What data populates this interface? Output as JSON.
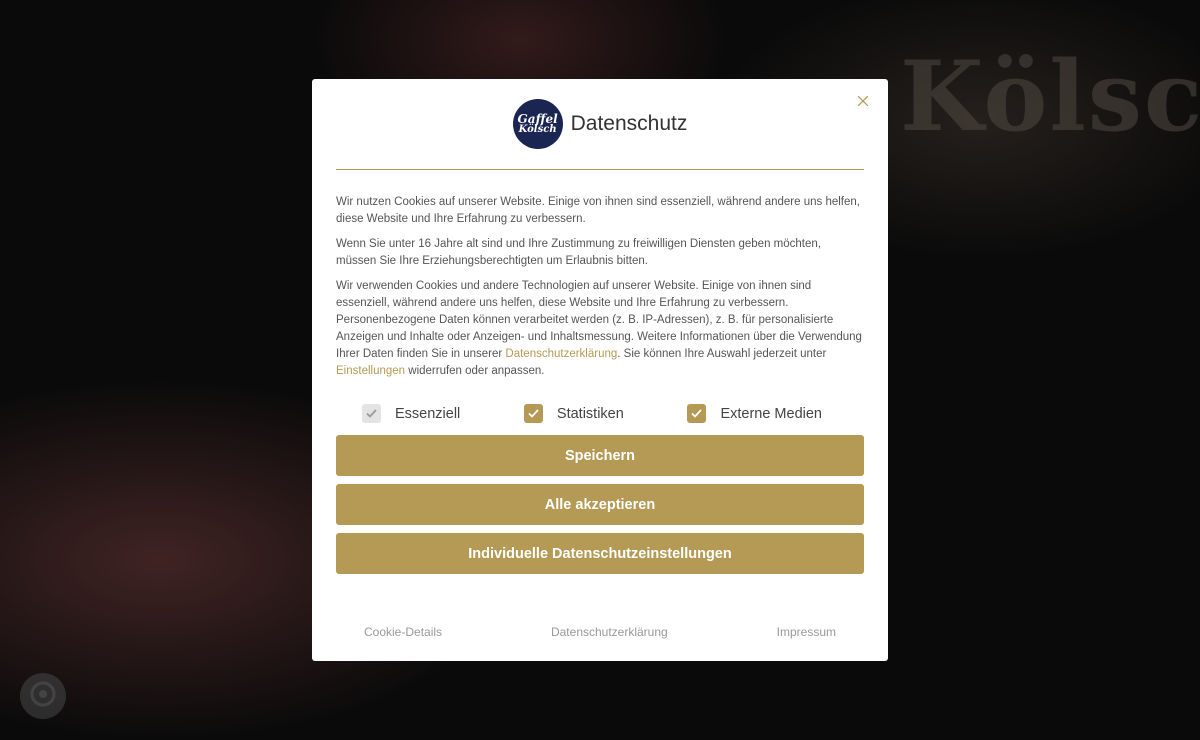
{
  "background": {
    "text": "Kölsch"
  },
  "modal": {
    "title": "Datenschutz",
    "logo": {
      "line1": "Gaffel",
      "line2": "Kölsch"
    },
    "paragraphs": [
      "Wir nutzen Cookies auf unserer Website. Einige von ihnen sind essenziell, während andere uns helfen, diese Website und Ihre Erfahrung zu verbessern.",
      "Wenn Sie unter 16 Jahre alt sind und Ihre Zustimmung zu freiwilligen Diensten geben möchten, müssen Sie Ihre Erziehungsberechtigten um Erlaubnis bitten."
    ],
    "p3": {
      "part1": "Wir verwenden Cookies und andere Technologien auf unserer Website. Einige von ihnen sind essenziell, während andere uns helfen, diese Website und Ihre Erfahrung zu verbessern. Personenbezogene Daten können verarbeitet werden (z. B. IP-Adressen), z. B. für personalisierte Anzeigen und Inhalte oder Anzeigen- und Inhaltsmessung. Weitere Informationen über die Verwendung Ihrer Daten finden Sie in unserer ",
      "link1": "Datenschutzerklärung",
      "part2": ". Sie können Ihre Auswahl jederzeit unter ",
      "link2": "Einstellungen",
      "part3": " widerrufen oder anpassen."
    },
    "checkboxes": [
      {
        "label": "Essenziell",
        "checked": true,
        "disabled": true
      },
      {
        "label": "Statistiken",
        "checked": true,
        "disabled": false
      },
      {
        "label": "Externe Medien",
        "checked": true,
        "disabled": false
      }
    ],
    "buttons": {
      "save": "Speichern",
      "accept_all": "Alle akzeptieren",
      "individual": "Individuelle Datenschutzeinstellungen"
    },
    "footer_links": {
      "cookie_details": "Cookie-Details",
      "privacy": "Datenschutzerklärung",
      "imprint": "Impressum"
    }
  },
  "colors": {
    "accent": "#b59a55",
    "logo_bg": "#1a2551"
  }
}
